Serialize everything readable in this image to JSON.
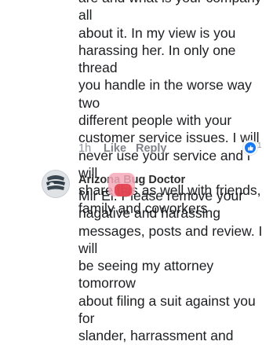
{
  "comments": [
    {
      "text": "are and what is your company  all\nabout it. In my view is you\nharassing her. In only one thread\nyou handle in the worse way two\ndifferent people with your\ncustomer service issues. I will\nnever use your service and i will\nshare this as well with friends,\nfamily and coworkers",
      "time": "1h",
      "like_label": "Like",
      "reply_label": "Reply",
      "reaction_icon": "like-reaction-icon",
      "reaction_count": "1"
    },
    {
      "author": "Arizona Bug Doctor",
      "text": "Mir Ei. Please remove your\nnagative and harassing\nmessages, posts and review. I will\nbe seeing my attorney tomorrow\nabout filing a suit against you for\nslander, harrassment and",
      "avatar_icon": "bug-logo-avatar"
    }
  ],
  "colors": {
    "text": "#1c1e21",
    "meta": "#90949c",
    "reaction": "#1877f2",
    "redaction": "#e0303c"
  }
}
